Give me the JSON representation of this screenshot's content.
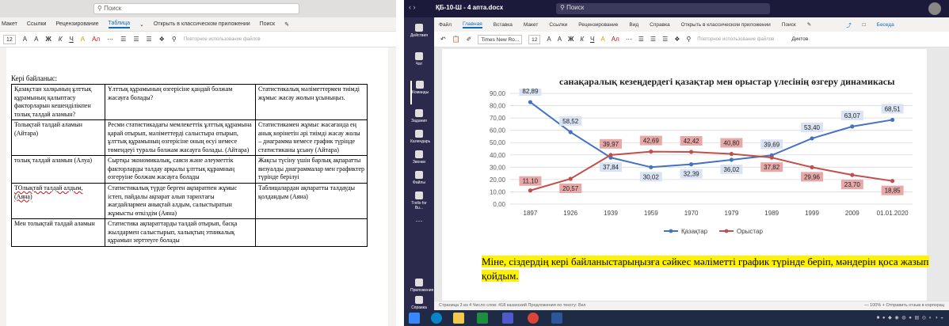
{
  "left": {
    "search_placeholder": "Поиск",
    "tabs": [
      "Макет",
      "Ссылки",
      "Рецензирование",
      "Таблица",
      "Открыть в классическом приложении",
      "Поиск"
    ],
    "active_tab": "Таблица",
    "font_size": "12",
    "ribbon_tools": [
      "A",
      "A",
      "Ж",
      "К",
      "Ч",
      "А",
      "Ал"
    ],
    "ribbon_hint": "Повторное использование файлов",
    "heading": "Кері байланыс:",
    "rows": [
      [
        "Қазақстан халқының ұлттық құрамының қалыптасу факторларын кешенділікпен толық талдай аламын?",
        "Ұлттық құрамының өзгерісіне қандай болжам жасауға болады?",
        "Статистикалық мәліметтермен тиімді жұмыс жасау жолын ұсыныңыз."
      ],
      [
        "Толықтай талдай аламын (Айтара)",
        "Ресми статистикадағы мемлекеттік ұлттық құрамына қарай отырып, мәліметтерді салыстыра отырып, ұлттық құрамының өзгерісіне оның өсуі немесе төмендеуі туралы болжам жасауға болады. (Айтара)",
        "Статистикамен жұмыс жасағанда ең анық көрінетін әрі тиімді жасау жолы – диаграмма немесе график түрінде статистиканы ұсыну (Айтара)"
      ],
      [
        "толық талдай аламын (Алуа)",
        "Сыртқы экономикалық, саяси және әлеуметтік факторларды талдау арқылы ұлттық құрамның өзгеруіне болжам жасауға болады",
        "Жақсы түсіну үшін барлық ақпаратты визуалды диаграммалар мен графиктер түрінде берілуі"
      ],
      [
        "ТОлықтай талдай алдым, (Аяна)",
        "Статистикалық түрде берген ақпаратпен жұмыс істеп, пайдалы ақпарат алып тарихтағы жағдайлармен анықтай алдым, салыстыратын жұмысты өткіздім (Аяна)",
        "Таблицалардан ақпаратты талдауды қолдандым (Аяна)"
      ],
      [
        "Мен толықтай талдай аламын",
        "Статистика ақпараттарды талдай отырып, басқа жылдармен салыстырып, халықтың этникалық құрамын зерттеуге болады",
        ""
      ]
    ]
  },
  "right": {
    "window_title": "ҚБ-10-Ш - 4 апта.docx",
    "search_placeholder": "Поиск",
    "tabs": [
      "Файл",
      "Главная",
      "Вставка",
      "Макет",
      "Ссылки",
      "Рецензирование",
      "Вид",
      "Справка",
      "Открыть в классическом приложении",
      "Поиск"
    ],
    "active_tab": "Главная",
    "font_name": "Times New Ro...",
    "font_size": "12",
    "ribbon_tools": [
      "A",
      "A",
      "Ж",
      "К",
      "Ч",
      "А",
      "Ал"
    ],
    "ribbon_hint": "Повторное использование файлов",
    "share_label": "Беседа",
    "dictate_label": "Диктов",
    "teams_items": [
      "Действия",
      "Чат",
      "Команды",
      "Задания",
      "Календарь",
      "Звонки",
      "Файлы",
      "Trello for Bu..."
    ],
    "help_label": "Справка",
    "apps_label": "Приложения",
    "message": "Міне, сіздердің кері байланыстарыңызға сәйкес мәліметті график түрінде беріп, мәндерін қоса жазып қойдым.",
    "status_left": "Страница 3 из 4    Число слов: 418    казахский    Предложения по тексту: Вкл",
    "status_right": "—     100%  +   Отправить отзыв в корпорац",
    "taskbar_tray": "■ ● ◆ ◉ ◍ ● ▤ ◎ ◐ ◑ ◒"
  },
  "colors": {
    "kazakh": "#4472c4",
    "russian": "#c0504d",
    "kazakh_label_bg": "#dae3f3",
    "russian_label_bg": "#e6a9a8"
  },
  "chart_data": {
    "type": "line",
    "title": "санақаралық кезеңдердегі қазақтар мен орыстар үлесінің өзгеру динамикасы",
    "xlabel": "",
    "ylabel": "",
    "categories": [
      "1897",
      "1926",
      "1939",
      "1959",
      "1970",
      "1979",
      "1989",
      "1999",
      "2009",
      "01.01.2020"
    ],
    "ylim": [
      0,
      90
    ],
    "yticks": [
      "0,00",
      "10,00",
      "20,00",
      "30,00",
      "40,00",
      "50,00",
      "60,00",
      "70,00",
      "80,00",
      "90,00"
    ],
    "grid": true,
    "legend_position": "bottom",
    "series": [
      {
        "name": "Қазақтар",
        "values": [
          82.89,
          58.52,
          37.84,
          30.02,
          32.39,
          36.02,
          39.69,
          53.4,
          63.07,
          68.51
        ],
        "labels": [
          "82,89",
          "58,52",
          "37,84",
          "30,02",
          "32,39",
          "36,02",
          "39,69",
          "53,40",
          "63,07",
          "68,51"
        ]
      },
      {
        "name": "Орыстар",
        "values": [
          11.1,
          20.57,
          39.97,
          42.69,
          42.42,
          40.8,
          37.82,
          29.96,
          23.7,
          18.85
        ],
        "labels": [
          "11,10",
          "20,57",
          "39,97",
          "42,69",
          "42,42",
          "40,80",
          "37,82",
          "29,96",
          "23,70",
          "18,85"
        ]
      }
    ]
  }
}
